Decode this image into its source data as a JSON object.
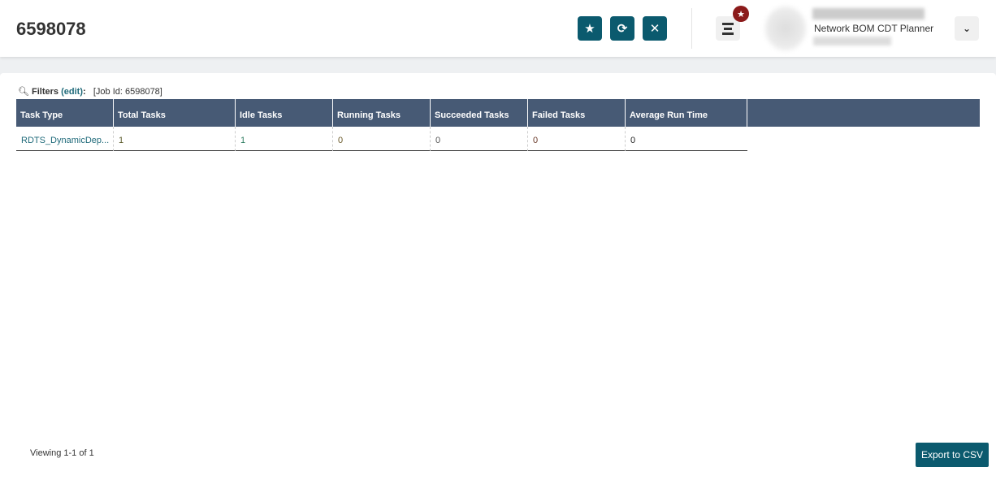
{
  "header": {
    "title": "6598078",
    "role": "Network BOM CDT Planner"
  },
  "filters": {
    "label": "Filters",
    "edit": "(edit)",
    "colon": ":",
    "value": "[Job Id: 6598078]"
  },
  "table": {
    "columns": [
      "Task Type",
      "Total Tasks",
      "Idle Tasks",
      "Running Tasks",
      "Succeeded Tasks",
      "Failed Tasks",
      "Average Run Time"
    ],
    "rows": [
      [
        "RDTS_DynamicDep...",
        "1",
        "1",
        "0",
        "0",
        "0",
        "0"
      ]
    ]
  },
  "footer": {
    "viewing": "Viewing 1-1 of 1",
    "export": "Export to CSV"
  }
}
